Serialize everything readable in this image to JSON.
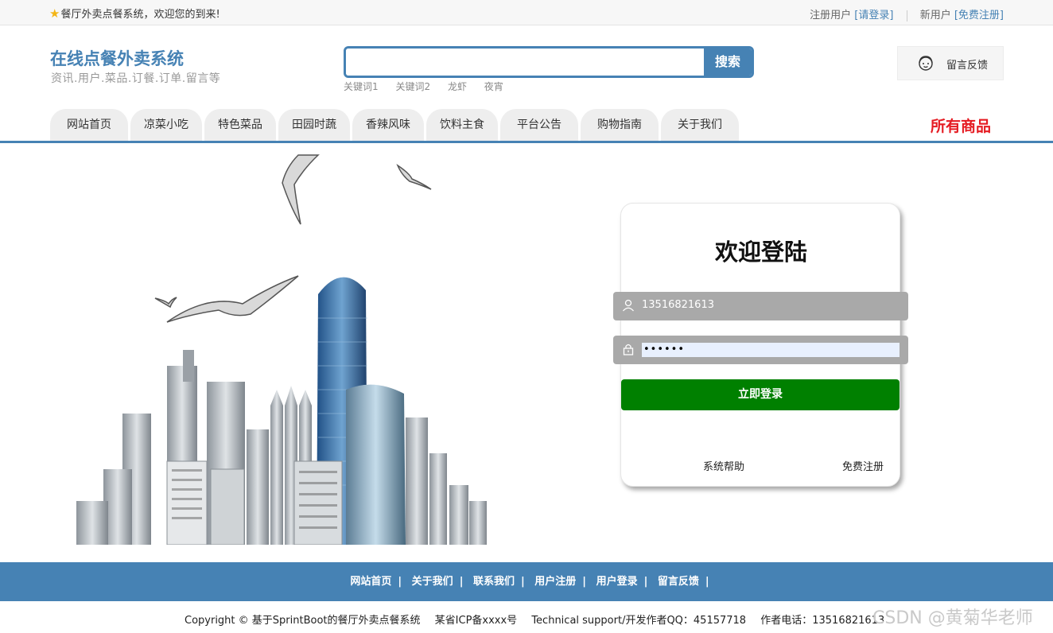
{
  "topbar": {
    "welcome": "餐厅外卖点餐系统，欢迎您的到来!",
    "registered_user": "注册用户",
    "login_link": "[请登录]",
    "new_user": "新用户",
    "register_link": "[免费注册]"
  },
  "header": {
    "title": "在线点餐外卖系统",
    "subtitle": "资讯.用户.菜品.订餐.订单.留言等",
    "search": {
      "placeholder": "",
      "button": "搜索"
    },
    "hotwords": [
      "关键词1",
      "关键词2",
      "龙虾",
      "夜宵"
    ],
    "feedback": "留言反馈"
  },
  "nav": {
    "tabs": [
      "网站首页",
      "凉菜小吃",
      "特色菜品",
      "田园时蔬",
      "香辣风味",
      "饮料主食",
      "平台公告",
      "购物指南",
      "关于我们"
    ],
    "all_products": "所有商品"
  },
  "login": {
    "title": "欢迎登陆",
    "username": "13516821613",
    "password_mask": "••••••",
    "submit": "立即登录",
    "help": "系统帮助",
    "register": "免费注册"
  },
  "footer": {
    "links": [
      "网站首页",
      "关于我们",
      "联系我们",
      "用户注册",
      "用户登录",
      "留言反馈"
    ],
    "copyright": "Copyright © 基于SprintBoot的餐厅外卖点餐系统",
    "icp": "某省ICP备xxxx号",
    "support": "Technical support/开发作者QQ：45157718",
    "phone": "作者电话：13516821613",
    "watermark": "CSDN @黄菊华老师"
  },
  "colors": {
    "accent": "#4682b4",
    "login_button": "#008000",
    "highlight": "#e51c23"
  }
}
